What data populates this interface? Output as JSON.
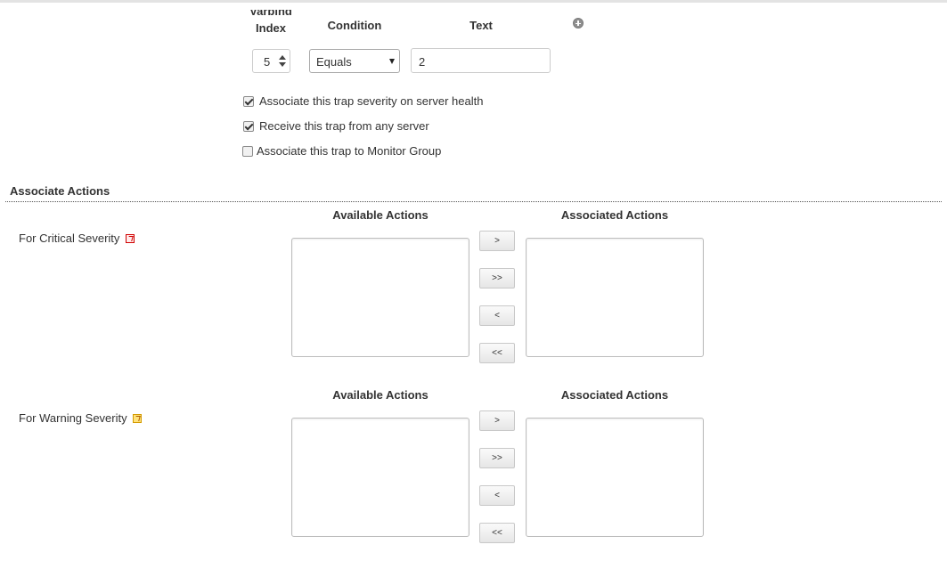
{
  "condition_row": {
    "headers": {
      "varbind_line1": "Varbind",
      "varbind_line2": "Index",
      "condition": "Condition",
      "text": "Text"
    },
    "add_icon": "plus-circle-icon",
    "varbind_index_value": "5",
    "condition_value": "Equals",
    "text_value": "2"
  },
  "options": [
    {
      "label": "Associate this trap severity on server health",
      "checked": true
    },
    {
      "label": "Receive this trap from any server",
      "checked": true
    },
    {
      "label": "Associate this trap to Monitor Group",
      "checked": false
    }
  ],
  "associate_actions": {
    "title": "Associate Actions",
    "blocks": [
      {
        "severity_label": "For Critical Severity",
        "severity_icon": "critical-severity-icon",
        "severity_color": "#d00000",
        "available_header": "Available Actions",
        "associated_header": "Associated Actions",
        "buttons": [
          ">",
          ">>",
          "<",
          "<<"
        ]
      },
      {
        "severity_label": "For Warning Severity",
        "severity_icon": "warning-severity-icon",
        "severity_color": "#e8a800",
        "available_header": "Available Actions",
        "associated_header": "Associated Actions",
        "buttons": [
          ">",
          ">>",
          "<",
          "<<"
        ]
      }
    ]
  }
}
